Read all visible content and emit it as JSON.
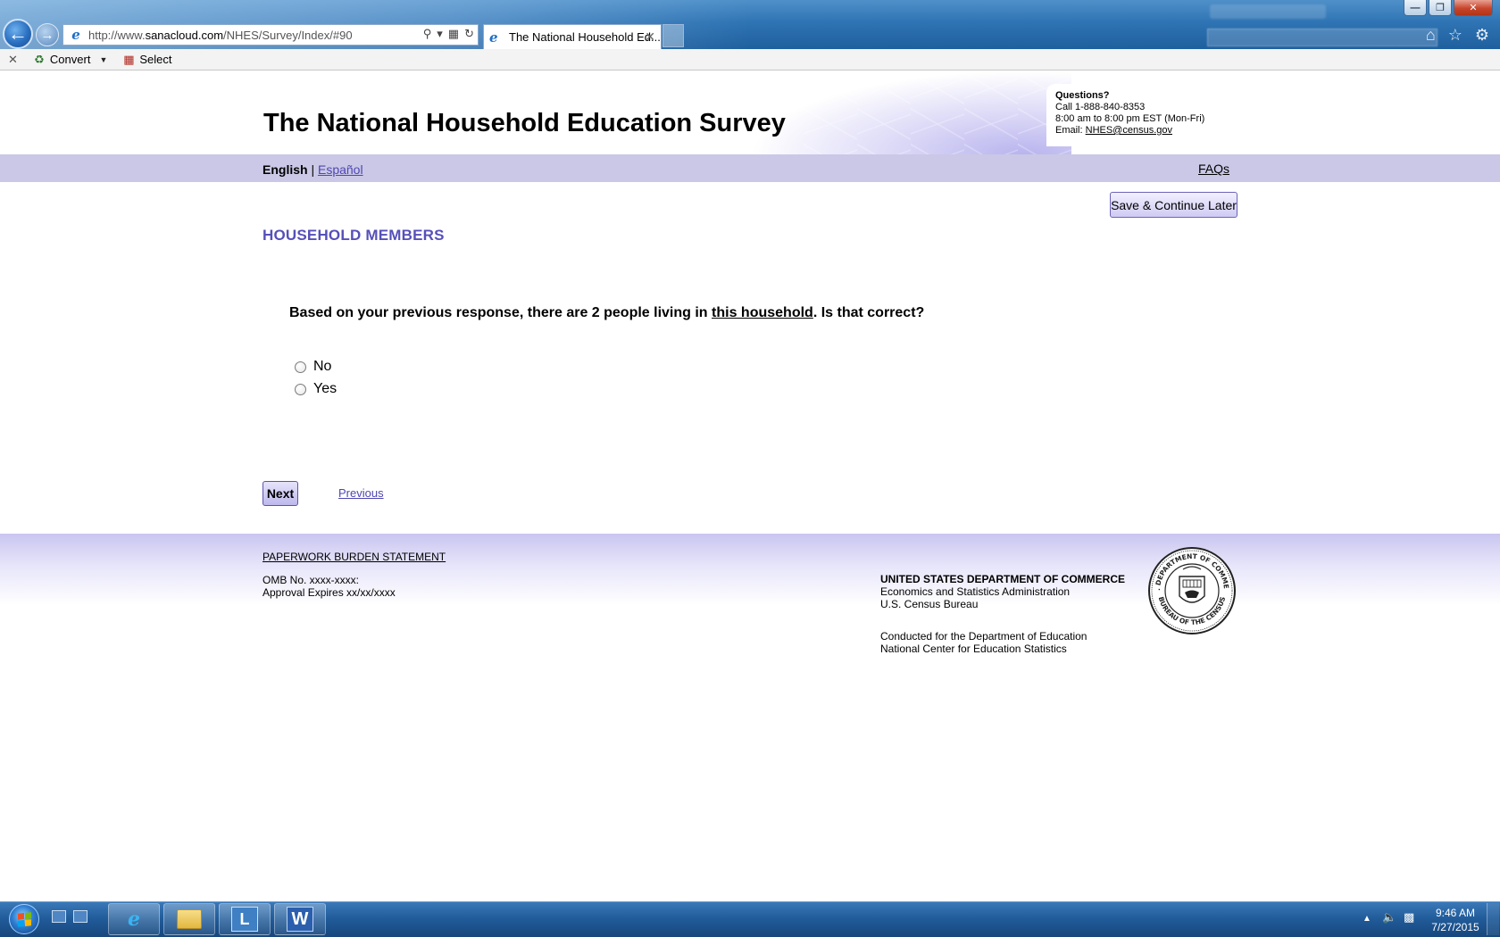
{
  "browser": {
    "address_url_prefix": "http://www.",
    "address_url_domain": "sanacloud.com",
    "address_url_path": "/NHES/Survey/Index/#90",
    "tab_title": "The National Household Ed...",
    "command_bar": {
      "convert_label": "Convert",
      "select_label": "Select"
    }
  },
  "header": {
    "site_title": "The National Household Education Survey",
    "contact": {
      "heading": "Questions?",
      "phone_line": "Call 1-888-840-8353",
      "hours_line": "8:00 am to 8:00 pm EST (Mon-Fri)",
      "email_label": "Email: ",
      "email_link": "NHES@census.gov"
    }
  },
  "nav": {
    "current_language": "English",
    "separator": " | ",
    "other_language": "Español",
    "faqs_label": "FAQs"
  },
  "main": {
    "save_button": "Save & Continue Later",
    "section_title": "HOUSEHOLD MEMBERS",
    "question_prefix": "Based on your previous response, there are 2 people living in ",
    "question_link": "this household",
    "question_suffix": ". Is that correct?",
    "options": [
      "No",
      "Yes"
    ],
    "next_button": "Next",
    "previous_link": "Previous"
  },
  "footer": {
    "paperwork_link": "PAPERWORK BURDEN STATEMENT",
    "omb_number": "OMB No. xxxx-xxxx:",
    "approval_expires": "Approval Expires xx/xx/xxxx",
    "dept_line1": "UNITED STATES DEPARTMENT OF COMMERCE",
    "dept_line2": "Economics and Statistics Administration",
    "dept_line3": "U.S. Census Bureau",
    "conducted_line1": "Conducted for the Department of Education",
    "conducted_line2": "National Center for Education Statistics",
    "seal_text_top": "U.S. DEPARTMENT OF COMMERCE",
    "seal_text_bottom": "BUREAU OF THE CENSUS"
  },
  "taskbar": {
    "time": "9:46 AM",
    "date": "7/27/2015",
    "lync_label": "L",
    "word_label": "W"
  },
  "icons": {
    "back": "arrow-left-icon",
    "forward": "arrow-right-icon",
    "ie": "internet-explorer-icon",
    "home": "home-icon",
    "favorites": "star-icon",
    "tools": "gear-icon"
  },
  "colors": {
    "section_title": "#5650b8",
    "lang_bar": "#cac8e6",
    "link": "#4f46b2"
  }
}
